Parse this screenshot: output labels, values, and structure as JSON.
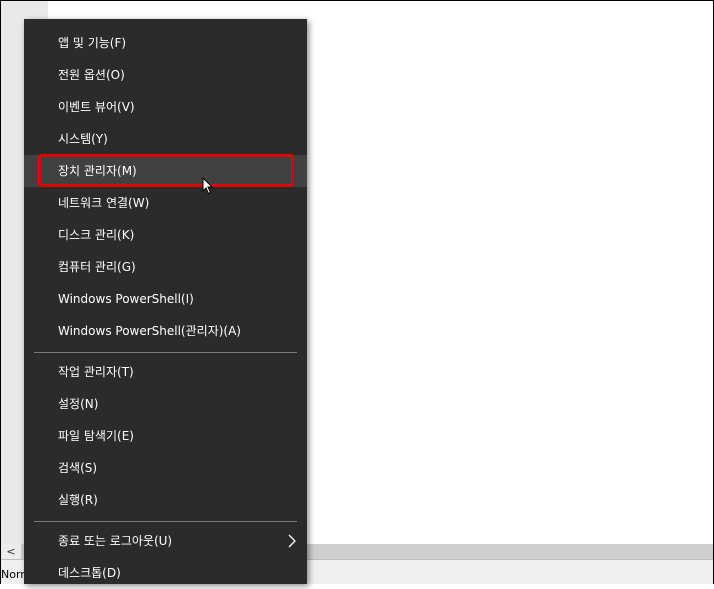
{
  "status": {
    "text": "Norn"
  },
  "scroll": {
    "left_arrow": "<"
  },
  "menu": {
    "groups": [
      {
        "items": [
          {
            "label": "앱 및 기능(F)"
          },
          {
            "label": "전원 옵션(O)"
          },
          {
            "label": "이벤트 뷰어(V)"
          },
          {
            "label": "시스템(Y)"
          },
          {
            "label": "장치 관리자(M)",
            "highlighted": true
          },
          {
            "label": "네트워크 연결(W)"
          },
          {
            "label": "디스크 관리(K)"
          },
          {
            "label": "컴퓨터 관리(G)"
          },
          {
            "label": "Windows PowerShell(I)"
          },
          {
            "label": "Windows PowerShell(관리자)(A)"
          }
        ]
      },
      {
        "items": [
          {
            "label": "작업 관리자(T)"
          },
          {
            "label": "설정(N)"
          },
          {
            "label": "파일 탐색기(E)"
          },
          {
            "label": "검색(S)"
          },
          {
            "label": "실행(R)"
          }
        ]
      },
      {
        "items": [
          {
            "label": "종료 또는 로그아웃(U)",
            "submenu": true
          },
          {
            "label": "데스크톱(D)"
          }
        ]
      }
    ]
  },
  "colors": {
    "menu_background": "#2b2b2b",
    "menu_text": "#ffffff",
    "hover_background": "#414141",
    "highlight_border": "#e00000"
  },
  "icons": {
    "submenu": "chevron-right-icon",
    "cursor": "mouse-pointer-icon"
  }
}
